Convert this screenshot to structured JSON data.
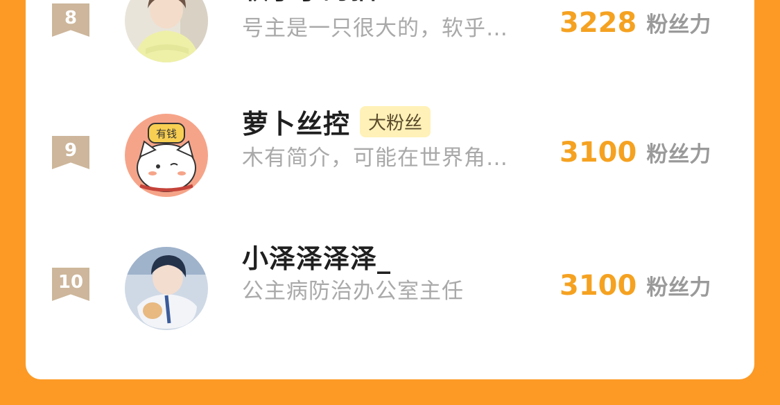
{
  "score_unit": "粉丝力",
  "colors": {
    "background": "#FC9A25",
    "score": "#F5A221",
    "rank_flag": "#CDB69B",
    "badge_bg": "#FFF1B8"
  },
  "rows": [
    {
      "rank": "8",
      "name": "软乎乎的猫SAMA",
      "badge": "",
      "bio": "号主是一只很大的，软乎…",
      "score": "3228",
      "avatar_icon": "person-photo-avatar"
    },
    {
      "rank": "9",
      "name": "萝卜丝控",
      "badge": "大粉丝",
      "bio": "木有简介，可能在世界角…",
      "score": "3100",
      "avatar_icon": "cartoon-cat-avatar",
      "avatar_text": "有钱"
    },
    {
      "rank": "10",
      "name": "小泽泽泽泽_",
      "badge": "",
      "bio": "公主病防治办公室主任",
      "score": "3100",
      "avatar_icon": "anime-boy-avatar"
    }
  ]
}
